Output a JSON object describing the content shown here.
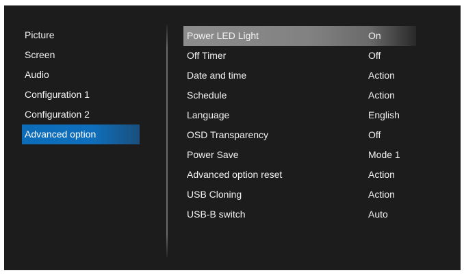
{
  "left_menu": {
    "items": [
      {
        "label": "Picture"
      },
      {
        "label": "Screen"
      },
      {
        "label": "Audio"
      },
      {
        "label": "Configuration 1"
      },
      {
        "label": "Configuration 2"
      },
      {
        "label": "Advanced option"
      }
    ],
    "active_index": 5
  },
  "settings": {
    "rows": [
      {
        "label": "Power LED Light",
        "value": "On"
      },
      {
        "label": "Off Timer",
        "value": "Off"
      },
      {
        "label": "Date and time",
        "value": "Action"
      },
      {
        "label": "Schedule",
        "value": "Action"
      },
      {
        "label": "Language",
        "value": "English"
      },
      {
        "label": "OSD Transparency",
        "value": "Off"
      },
      {
        "label": "Power Save",
        "value": "Mode 1"
      },
      {
        "label": "Advanced option reset",
        "value": "Action"
      },
      {
        "label": "USB Cloning",
        "value": "Action"
      },
      {
        "label": "USB-B switch",
        "value": "Auto"
      }
    ],
    "highlighted_index": 0
  },
  "colors": {
    "background": "#1c1c1c",
    "active_menu": "#0f6fbc",
    "highlight_row": "#858585"
  }
}
